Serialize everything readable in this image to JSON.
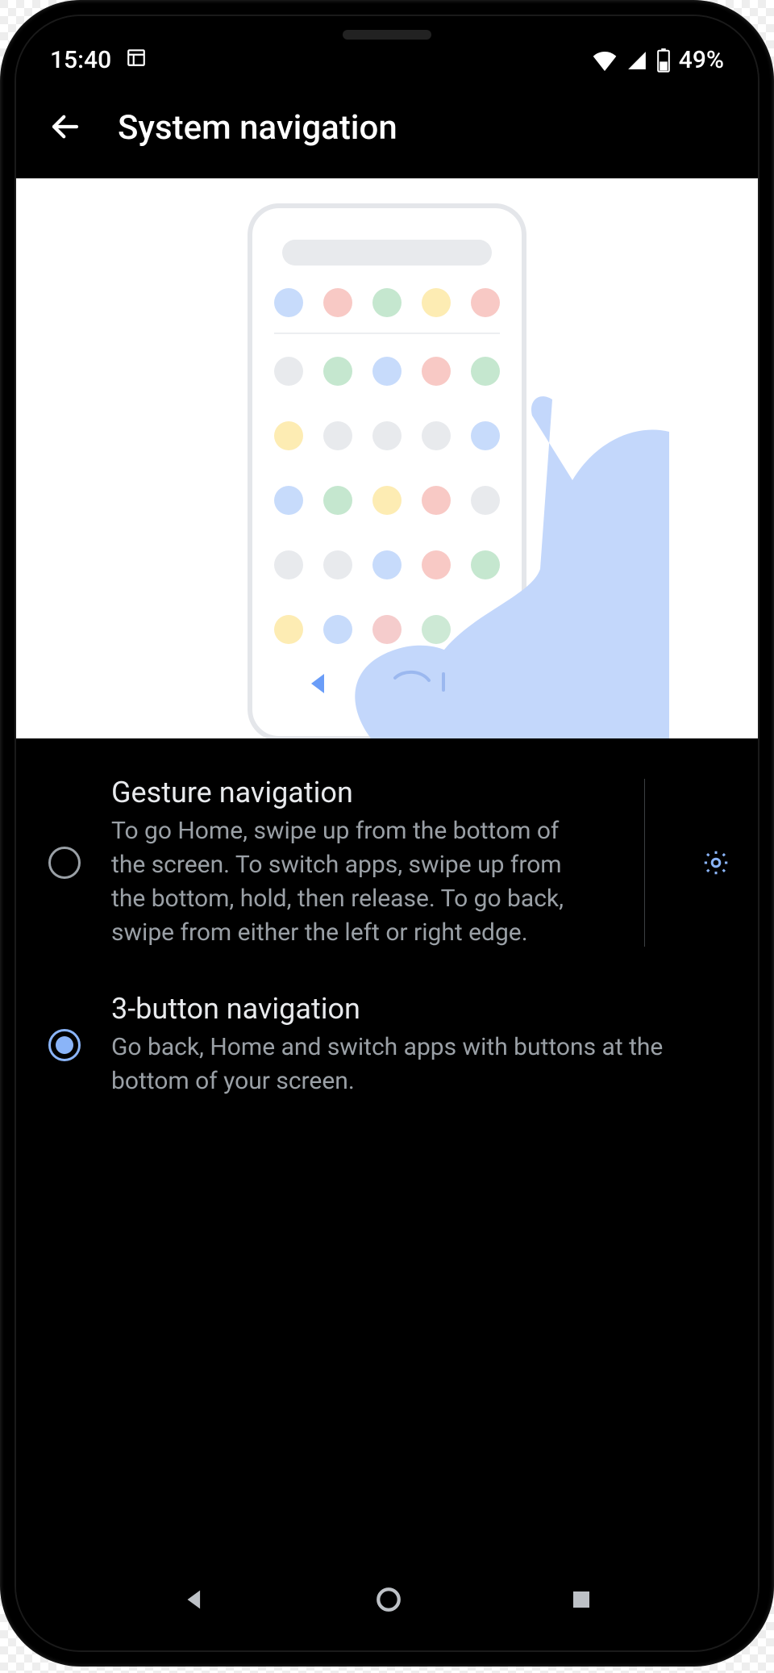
{
  "status_bar": {
    "time": "15:40",
    "battery_pct": "49%"
  },
  "app_bar": {
    "title": "System navigation"
  },
  "options": [
    {
      "title": "Gesture navigation",
      "description": "To go Home, swipe up from the bottom of the screen. To switch apps, swipe up from the bottom, hold, then release. To go back, swipe from either the left or right edge.",
      "selected": false,
      "has_settings": true
    },
    {
      "title": "3-button navigation",
      "description": "Go back, Home and switch apps with buttons at the bottom of your screen.",
      "selected": true,
      "has_settings": false
    }
  ]
}
